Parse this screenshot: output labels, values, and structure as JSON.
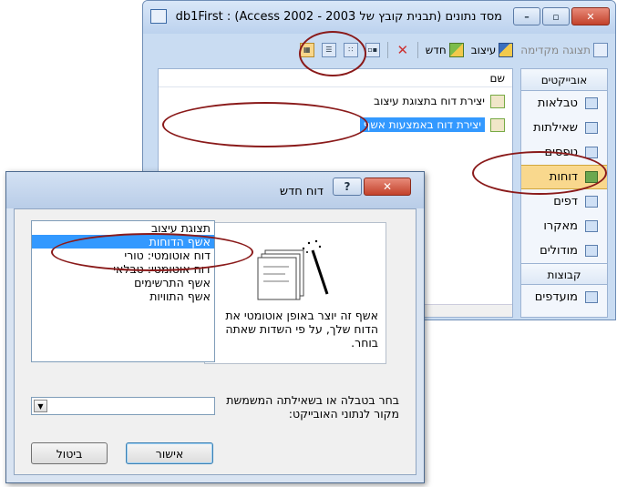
{
  "db_window": {
    "title": "מסד נתונים (תבנית קובץ של Access 2002 - 2003) : db1First",
    "controls": {
      "minimize": "–",
      "maximize": "▫",
      "close": "✕"
    },
    "toolbar": {
      "preview_label": "תצוגה מקדימה",
      "design_label": "עיצוב",
      "new_label": "חדש"
    },
    "objects": {
      "header": "אובייקטים",
      "items": [
        "טבלאות",
        "שאילתות",
        "טפסים",
        "דוחות",
        "דפים",
        "מאקרו",
        "מודולים"
      ],
      "selected": "דוחות",
      "groups_header": "קבוצות",
      "favorites": "מועדפים"
    },
    "list": {
      "column_name": "שם",
      "rows": [
        "יצירת דוח בתצוגת עיצוב",
        "יצירת דוח באמצעות אשף"
      ]
    }
  },
  "dialog": {
    "title": "דוח חדש",
    "help_label": "?",
    "close_label": "✕",
    "description": "אשף זה יוצר באופן אוטומטי את הדוח שלך, על פי השדות שאתה בוחר.",
    "report_types": [
      "תצוגת עיצוב",
      "אשף הדוחות",
      "דוח אוטומטי: טורי",
      "דוח אוטומטי: טבלאי",
      "אשף התרשימים",
      "אשף התוויות"
    ],
    "selected_type": "אשף הדוחות",
    "source_label": "בחר בטבלה או בשאילתה המשמשת מקור לנתוני האובייקט:",
    "source_value": "",
    "ok_label": "אישור",
    "cancel_label": "ביטול"
  },
  "colors": {
    "selection": "#3399ff",
    "selected_object": "#f9d88d",
    "annotation": "#8a1a1a"
  }
}
